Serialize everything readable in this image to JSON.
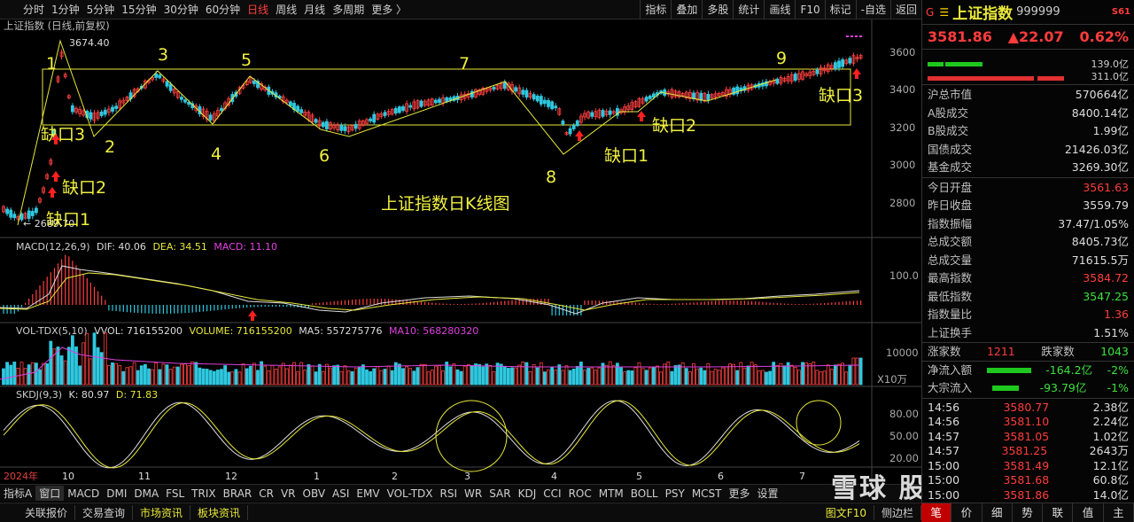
{
  "toolbar": {
    "periods": [
      "分时",
      "1分钟",
      "5分钟",
      "15分钟",
      "30分钟",
      "60分钟",
      "日线",
      "周线",
      "月线",
      "多周期",
      "更多 〉"
    ],
    "active_period": "日线",
    "tools": [
      "指标",
      "叠加",
      "多股",
      "统计",
      "画线",
      "F10",
      "标记",
      "-自选",
      "返回"
    ]
  },
  "main_chart": {
    "title": "上证指数 (日线,前复权)",
    "high_label": "3674.40",
    "low_label": "← 2689.70",
    "y_ticks": [
      "3600",
      "3400",
      "3200",
      "3000",
      "2800"
    ],
    "wave_labels": [
      "1",
      "2",
      "3",
      "4",
      "5",
      "6",
      "7",
      "8",
      "9"
    ],
    "gap_labels": [
      "缺口1",
      "缺口2",
      "缺口3",
      "缺口1",
      "缺口2",
      "缺口3"
    ],
    "center_title": "上证指数日K线图"
  },
  "macd": {
    "name": "MACD(12,26,9)",
    "dif": "DIF: 40.06",
    "dea": "DEA: 34.51",
    "macd": "MACD: 11.10",
    "tick": "100.0"
  },
  "vol": {
    "name": "VOL-TDX(5,10)",
    "vvol": "VVOL: 716155200",
    "volume": "VOLUME: 716155200",
    "ma5": "MA5: 557275776",
    "ma10": "MA10: 568280320",
    "tick": "10000",
    "unit": "X10万"
  },
  "skdj": {
    "name": "SKDJ(9,3)",
    "k": "K: 80.97",
    "d": "D: 71.83",
    "ticks": [
      "80.00",
      "50.00",
      "20.00"
    ]
  },
  "x_axis": [
    "2024年",
    "10",
    "11",
    "12",
    "1",
    "2",
    "3",
    "4",
    "5",
    "6",
    "7"
  ],
  "indicator_tabs": [
    "指标A",
    "窗口",
    "MACD",
    "DMI",
    "DMA",
    "FSL",
    "TRIX",
    "BRAR",
    "CR",
    "VR",
    "OBV",
    "ASI",
    "EMV",
    "VOL-TDX",
    "RSI",
    "WR",
    "SAR",
    "KDJ",
    "CCI",
    "ROC",
    "MTM",
    "BOLL",
    "PSY",
    "MCST",
    "更多",
    "设置"
  ],
  "status_buttons": [
    "关联报价",
    "交易查询",
    "市场资讯",
    "板块资讯"
  ],
  "status_right": [
    "图文F10",
    "侧边栏"
  ],
  "quote": {
    "g_icon": "G",
    "name": "上证指数",
    "code": "999999",
    "s_badge": "S61",
    "price": "3581.86",
    "change": "▲22.07",
    "change_pct": "0.62%",
    "buy_vol": "139.0亿",
    "sell_vol": "311.0亿",
    "rows1": [
      {
        "k": "沪总市值",
        "v": "570664亿"
      },
      {
        "k": "A股成交",
        "v": "8400.14亿"
      },
      {
        "k": "B股成交",
        "v": "1.99亿"
      },
      {
        "k": "国债成交",
        "v": "21426.03亿"
      },
      {
        "k": "基金成交",
        "v": "3269.30亿"
      }
    ],
    "rows2": [
      {
        "k": "今日开盘",
        "v": "3561.63"
      },
      {
        "k": "昨日收盘",
        "v": "3559.79"
      },
      {
        "k": "指数振幅",
        "v": "37.47/1.05%"
      },
      {
        "k": "总成交额",
        "v": "8405.73亿"
      },
      {
        "k": "总成交量",
        "v": "71615.5万"
      },
      {
        "k": "最高指数",
        "v": "3584.72"
      },
      {
        "k": "最低指数",
        "v": "3547.25"
      },
      {
        "k": "指数量比",
        "v": "1.36"
      },
      {
        "k": "上证换手",
        "v": "1.51%"
      }
    ],
    "rise_label": "涨家数",
    "rise": "1211",
    "fall_label": "跌家数",
    "fall": "1043",
    "inflow_label": "净流入额",
    "inflow": "-164.2亿",
    "inflow_pct": "-2%",
    "block_label": "大宗流入",
    "block": "-93.79亿",
    "block_pct": "-1%",
    "ticks": [
      {
        "t": "14:56",
        "p": "3580.77",
        "v": "2.38亿"
      },
      {
        "t": "14:56",
        "p": "3581.10",
        "v": "2.24亿"
      },
      {
        "t": "14:57",
        "p": "3581.05",
        "v": "1.02亿"
      },
      {
        "t": "14:57",
        "p": "3581.25",
        "v": "2643万"
      },
      {
        "t": "15:00",
        "p": "3581.49",
        "v": "12.1亿"
      },
      {
        "t": "15:00",
        "p": "3581.68",
        "v": "60.8亿"
      },
      {
        "t": "15:00",
        "p": "3581.86",
        "v": "14.0亿"
      }
    ],
    "side_tabs": [
      "笔",
      "价",
      "细",
      "势",
      "联",
      "值",
      "主"
    ]
  },
  "watermark": "雪球  股海禅思"
}
